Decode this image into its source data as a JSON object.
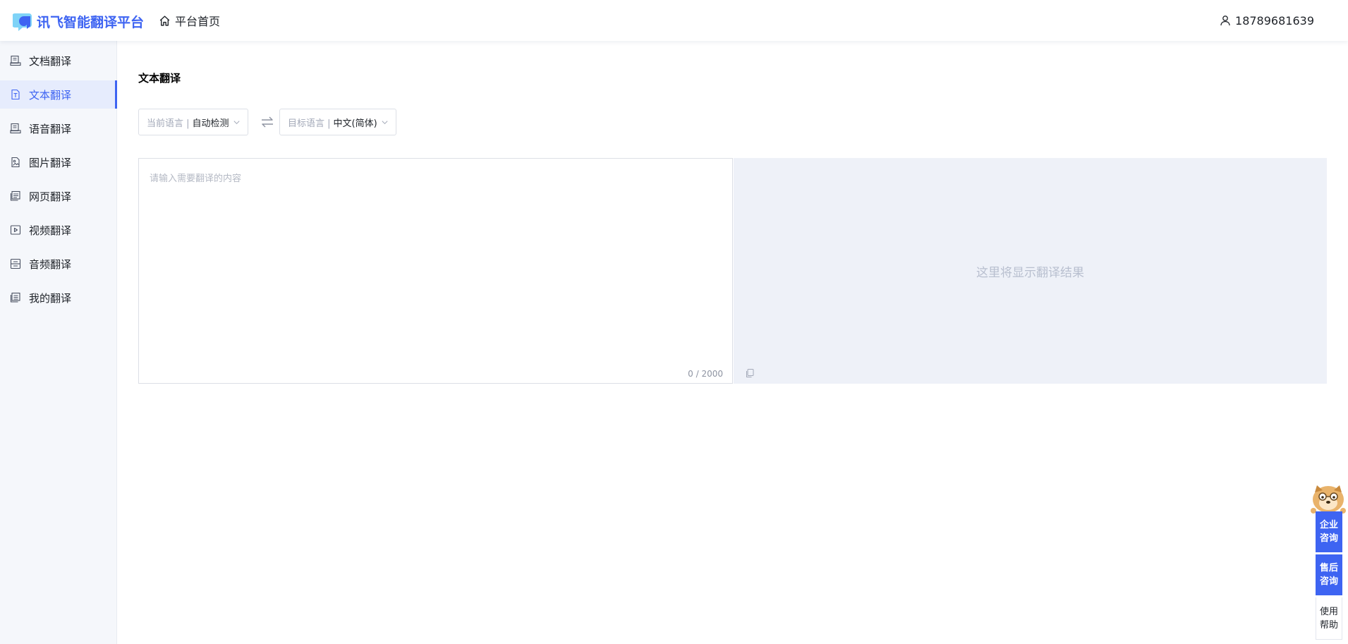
{
  "header": {
    "logo_text": "讯飞智能翻译平台",
    "home_label": "平台首页",
    "user_phone": "18789681639"
  },
  "sidebar": {
    "items": [
      {
        "label": "文档翻译",
        "icon": "document-icon",
        "active": false
      },
      {
        "label": "文本翻译",
        "icon": "text-icon",
        "active": true
      },
      {
        "label": "语音翻译",
        "icon": "voice-icon",
        "active": false
      },
      {
        "label": "图片翻译",
        "icon": "image-icon",
        "active": false
      },
      {
        "label": "网页翻译",
        "icon": "webpage-icon",
        "active": false
      },
      {
        "label": "视频翻译",
        "icon": "video-icon",
        "active": false
      },
      {
        "label": "音频翻译",
        "icon": "audio-icon",
        "active": false
      },
      {
        "label": "我的翻译",
        "icon": "my-translation-icon",
        "active": false
      }
    ]
  },
  "main": {
    "title": "文本翻译",
    "source_lang": {
      "label": "当前语言 |",
      "value": "自动检测"
    },
    "target_lang": {
      "label": "目标语言 |",
      "value": "中文(简体)"
    },
    "input_placeholder": "请输入需要翻译的内容",
    "input_value": "",
    "counter": "0 / 2000",
    "output_placeholder": "这里将显示翻译结果"
  },
  "float_widget": {
    "enterprise": "企业咨询",
    "after_sales": "售后咨询",
    "help": "使用帮助"
  },
  "colors": {
    "accent": "#3e64f2",
    "sidebar_bg": "#f5f7fb",
    "output_bg": "#eef1f8"
  }
}
